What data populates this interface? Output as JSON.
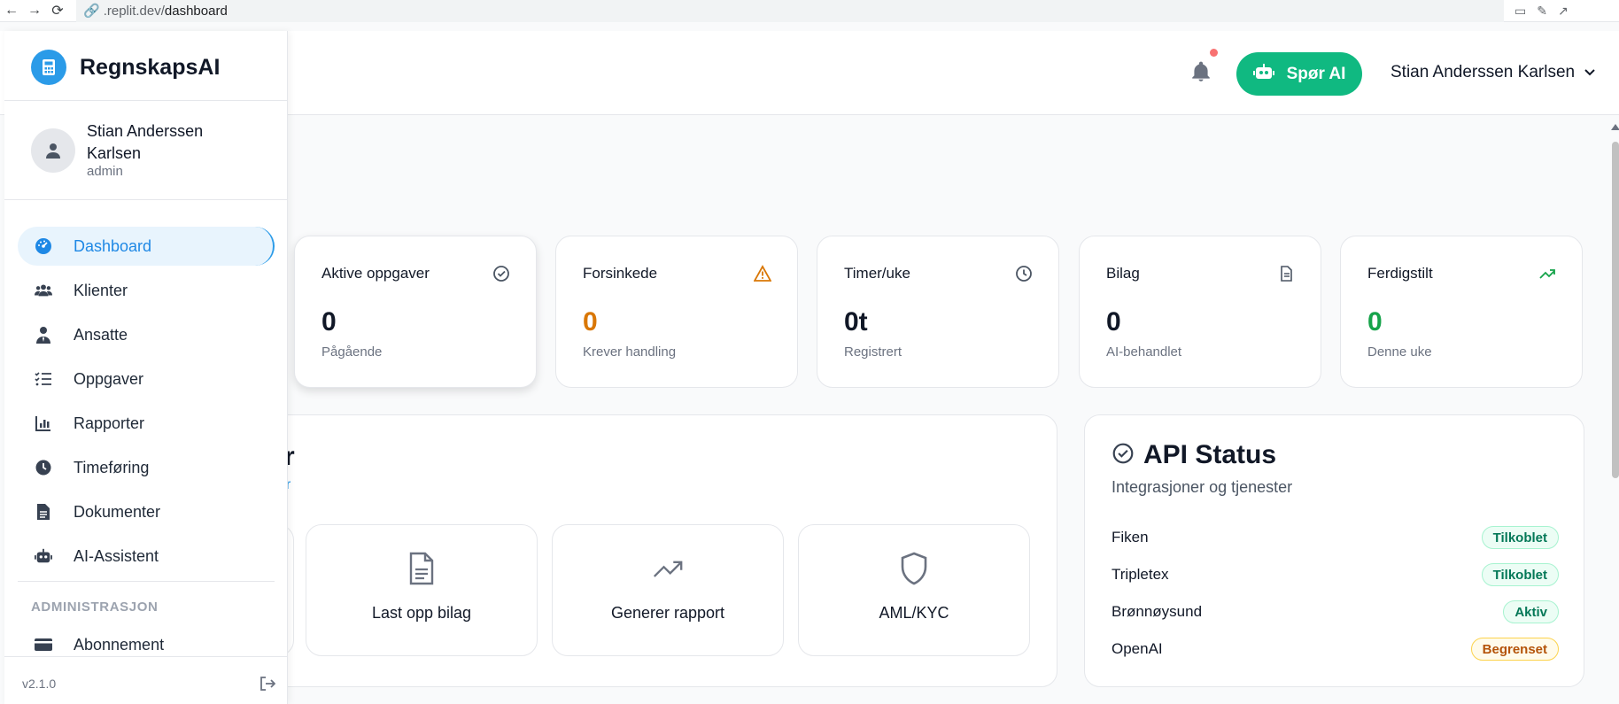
{
  "browser": {
    "url_host": ".replit.dev/",
    "url_path": "dashboard"
  },
  "brand": {
    "name": "RegnskapsAI"
  },
  "profile": {
    "name": "Stian Anderssen Karlsen",
    "role": "admin"
  },
  "sidebar": {
    "items": [
      {
        "label": "Dashboard",
        "icon": "gauge-icon",
        "active": true
      },
      {
        "label": "Klienter",
        "icon": "users-icon"
      },
      {
        "label": "Ansatte",
        "icon": "user-tie-icon"
      },
      {
        "label": "Oppgaver",
        "icon": "task-list-icon"
      },
      {
        "label": "Rapporter",
        "icon": "bar-chart-icon"
      },
      {
        "label": "Timeføring",
        "icon": "clock-icon"
      },
      {
        "label": "Dokumenter",
        "icon": "document-icon"
      },
      {
        "label": "AI-Assistent",
        "icon": "robot-icon"
      }
    ],
    "section_label": "ADMINISTRASJON",
    "admin_items": [
      {
        "label": "Abonnement",
        "icon": "credit-card-icon"
      }
    ],
    "version": "v2.1.0"
  },
  "header": {
    "ask_ai_label": "Spør AI",
    "user_name": "Stian Anderssen Karlsen"
  },
  "stats": [
    {
      "title": "Aktive oppgaver",
      "value": "0",
      "sub": "Pågående",
      "icon": "check-circle-icon",
      "color": "#111827"
    },
    {
      "title": "Forsinkede",
      "value": "0",
      "sub": "Krever handling",
      "icon": "warning-icon",
      "color": "#d97706"
    },
    {
      "title": "Timer/uke",
      "value": "0t",
      "sub": "Registrert",
      "icon": "clock-icon",
      "color": "#111827"
    },
    {
      "title": "Bilag",
      "value": "0",
      "sub": "AI-behandlet",
      "icon": "document-icon",
      "color": "#111827"
    },
    {
      "title": "Ferdigstilt",
      "value": "0",
      "sub": "Denne uke",
      "icon": "trending-up-icon",
      "color": "#16a34a"
    }
  ],
  "quick_actions": {
    "title_fragment": "r",
    "sub_fragment": "r",
    "tiles": [
      {
        "label": "Last opp bilag",
        "icon": "document-icon"
      },
      {
        "label": "Generer rapport",
        "icon": "trending-up-icon"
      },
      {
        "label": "AML/KYC",
        "icon": "shield-icon"
      }
    ]
  },
  "api_status": {
    "title": "API Status",
    "subtitle": "Integrasjoner og tjenester",
    "rows": [
      {
        "name": "Fiken",
        "status": "Tilkoblet",
        "kind": "ok"
      },
      {
        "name": "Tripletex",
        "status": "Tilkoblet",
        "kind": "ok"
      },
      {
        "name": "Brønnøysund",
        "status": "Aktiv",
        "kind": "ok"
      },
      {
        "name": "OpenAI",
        "status": "Begrenset",
        "kind": "warn"
      }
    ]
  },
  "colors": {
    "accent": "#2b9be8",
    "primary_button": "#10b981",
    "warning": "#d97706",
    "success": "#16a34a"
  }
}
